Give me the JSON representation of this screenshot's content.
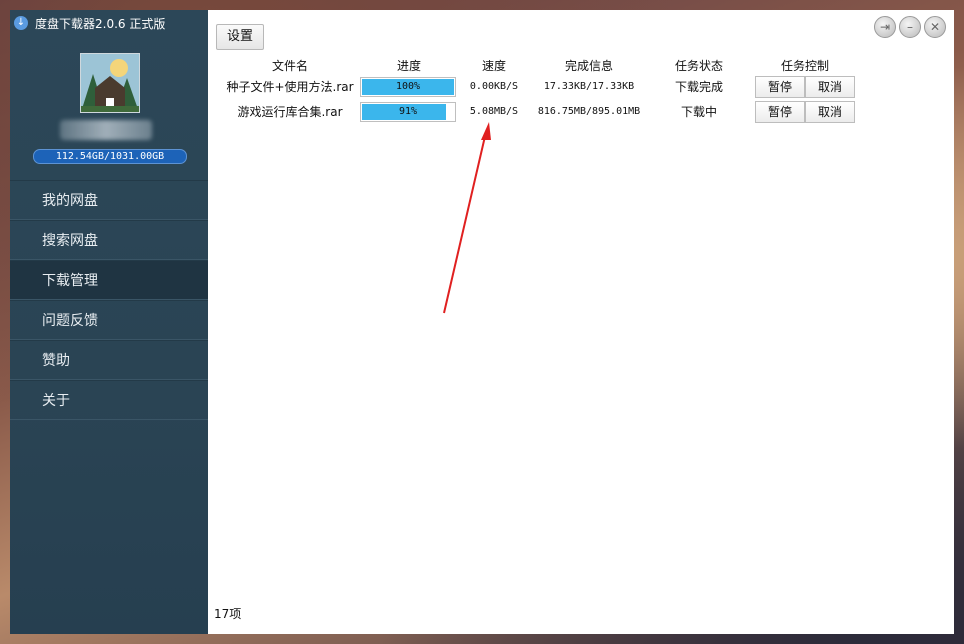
{
  "app": {
    "title": "度盘下载器2.0.6 正式版",
    "quota": "112.54GB/1031.00GB"
  },
  "sidebar": {
    "items": [
      {
        "label": "我的网盘"
      },
      {
        "label": "搜索网盘"
      },
      {
        "label": "下载管理"
      },
      {
        "label": "问题反馈"
      },
      {
        "label": "赞助"
      },
      {
        "label": "关于"
      }
    ],
    "active_index": 2
  },
  "toolbar": {
    "settings_label": "设置"
  },
  "table": {
    "headers": [
      "文件名",
      "进度",
      "速度",
      "完成信息",
      "任务状态",
      "任务控制"
    ],
    "rows": [
      {
        "name": "种子文件+使用方法.rar",
        "progress_label": "100%",
        "progress": 1.0,
        "speed": "0.00KB/S",
        "done_info": "17.33KB/17.33KB",
        "state": "下载完成",
        "pause_label": "暂停",
        "cancel_label": "取消"
      },
      {
        "name": "游戏运行库合集.rar",
        "progress_label": "91%",
        "progress": 0.91,
        "speed": "5.08MB/S",
        "done_info": "816.75MB/895.01MB",
        "state": "下载中",
        "pause_label": "暂停",
        "cancel_label": "取消"
      }
    ]
  },
  "footer": {
    "count": "17项"
  },
  "colors": {
    "progress_fill": "#3bb6ec",
    "quota_bar": "#1d63b8",
    "sidebar_bg": "#2c4758",
    "annotation_arrow": "#e02020"
  },
  "icons": {
    "app": "download-icon",
    "window": [
      "exit-icon",
      "minimize-icon",
      "close-icon"
    ]
  }
}
